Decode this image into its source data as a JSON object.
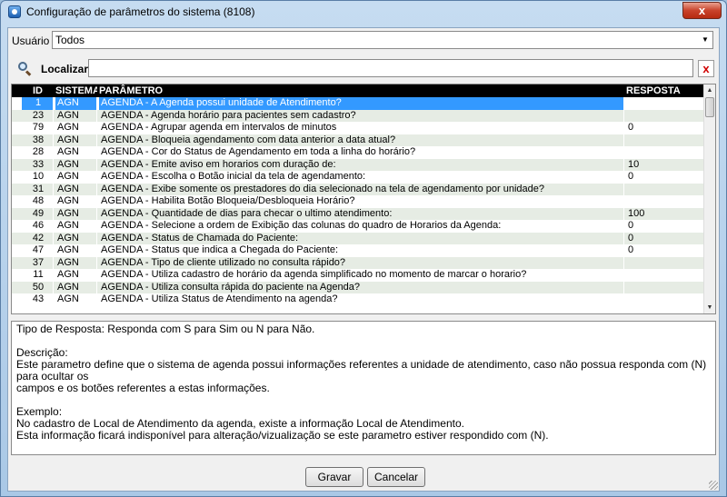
{
  "window": {
    "title": "Configuração de parâmetros do sistema (8108)",
    "close_glyph": "x"
  },
  "user_filter": {
    "label": "Usuário",
    "value": "Todos",
    "arrow_glyph": "▼"
  },
  "search": {
    "label": "Localizar",
    "value": "",
    "clear_glyph": "x"
  },
  "grid": {
    "columns": {
      "id": "ID",
      "system": "SISTEMA",
      "parameter": "PARÂMETRO",
      "response": "RESPOSTA"
    },
    "selected_index": 0,
    "rows": [
      {
        "id": "1",
        "system": "AGN",
        "parameter": "AGENDA - A Agenda possui unidade de Atendimento?",
        "response": ""
      },
      {
        "id": "23",
        "system": "AGN",
        "parameter": "AGENDA - Agenda horário para pacientes sem cadastro?",
        "response": ""
      },
      {
        "id": "79",
        "system": "AGN",
        "parameter": "AGENDA - Agrupar agenda em intervalos de minutos",
        "response": "0"
      },
      {
        "id": "38",
        "system": "AGN",
        "parameter": "AGENDA - Bloqueia agendamento com data anterior a data atual?",
        "response": ""
      },
      {
        "id": "28",
        "system": "AGN",
        "parameter": "AGENDA - Cor do Status de Agendamento em toda a linha do horário?",
        "response": ""
      },
      {
        "id": "33",
        "system": "AGN",
        "parameter": "AGENDA - Emite aviso em horarios com duração de:",
        "response": "10"
      },
      {
        "id": "10",
        "system": "AGN",
        "parameter": "AGENDA - Escolha o Botão inicial da tela de agendamento:",
        "response": "0"
      },
      {
        "id": "31",
        "system": "AGN",
        "parameter": "AGENDA - Exibe somente os prestadores do dia selecionado na tela de agendamento por unidade?",
        "response": ""
      },
      {
        "id": "48",
        "system": "AGN",
        "parameter": "AGENDA - Habilita Botão Bloqueia/Desbloqueia Horário?",
        "response": ""
      },
      {
        "id": "49",
        "system": "AGN",
        "parameter": "AGENDA - Quantidade de dias para checar o ultimo atendimento:",
        "response": "100"
      },
      {
        "id": "46",
        "system": "AGN",
        "parameter": "AGENDA - Selecione a ordem de Exibição das colunas do quadro de Horarios da Agenda:",
        "response": "0"
      },
      {
        "id": "42",
        "system": "AGN",
        "parameter": "AGENDA - Status de Chamada do Paciente:",
        "response": "0"
      },
      {
        "id": "47",
        "system": "AGN",
        "parameter": "AGENDA - Status que indica a Chegada do Paciente:",
        "response": "0"
      },
      {
        "id": "37",
        "system": "AGN",
        "parameter": "AGENDA - Tipo de cliente utilizado no consulta rápido?",
        "response": ""
      },
      {
        "id": "11",
        "system": "AGN",
        "parameter": "AGENDA - Utiliza cadastro de horário da agenda simplificado no momento de marcar o horario?",
        "response": ""
      },
      {
        "id": "50",
        "system": "AGN",
        "parameter": "AGENDA - Utiliza consulta rápida do paciente na Agenda?",
        "response": ""
      },
      {
        "id": "43",
        "system": "AGN",
        "parameter": "AGENDA - Utiliza Status de Atendimento na agenda?",
        "response": ""
      }
    ],
    "scroll": {
      "up_glyph": "▲",
      "down_glyph": "▼"
    }
  },
  "description": {
    "lines": [
      "Tipo de Resposta: Responda com S para Sim ou N para Não.",
      "",
      "Descrição:",
      "Este parametro define que o sistema de agenda possui informações referentes a unidade de atendimento, caso não possua responda com (N) para ocultar os",
      "campos e os botões referentes a estas informações.",
      "",
      "Exemplo:",
      "No cadastro de Local de Atendimento da agenda, existe a informação Local de Atendimento.",
      "Esta informação ficará indisponível para alteração/vizualização se este parametro estiver respondido com (N)."
    ]
  },
  "buttons": {
    "save": "Gravar",
    "cancel": "Cancelar"
  }
}
